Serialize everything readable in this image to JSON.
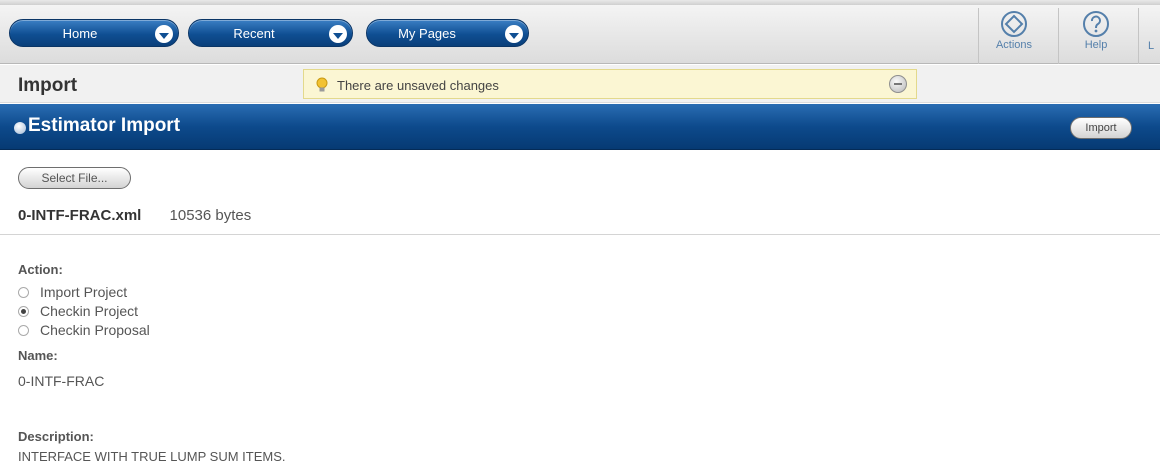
{
  "nav": {
    "home_label": "Home",
    "recent_label": "Recent",
    "mypages_label": "My Pages"
  },
  "toolbar": {
    "actions_label": "Actions",
    "help_label": "Help",
    "cut_label": "L"
  },
  "page": {
    "title": "Import",
    "unsaved_message": "There are unsaved changes"
  },
  "section": {
    "title": "Estimator Import",
    "import_button": "Import",
    "select_file_button": "Select File..."
  },
  "file": {
    "name": "0-INTF-FRAC.xml",
    "size": "10536 bytes"
  },
  "form": {
    "action_label": "Action:",
    "actions": [
      {
        "label": "Import Project",
        "checked": false
      },
      {
        "label": "Checkin Project",
        "checked": true
      },
      {
        "label": "Checkin Proposal",
        "checked": false
      }
    ],
    "name_label": "Name:",
    "name_value": "0-INTF-FRAC",
    "description_label": "Description:",
    "description_value": "INTERFACE WITH TRUE LUMP SUM ITEMS."
  },
  "colors": {
    "nav_blue": "#0f4f93",
    "header_blue": "#0d4a8c",
    "notice_bg": "#fbf6d3",
    "toolbar_text": "#5580ab"
  },
  "icons": {
    "actions": "diamond-circle-icon",
    "help": "question-circle-icon",
    "notice": "lightbulb-icon",
    "dismiss": "minus-circle-icon"
  }
}
